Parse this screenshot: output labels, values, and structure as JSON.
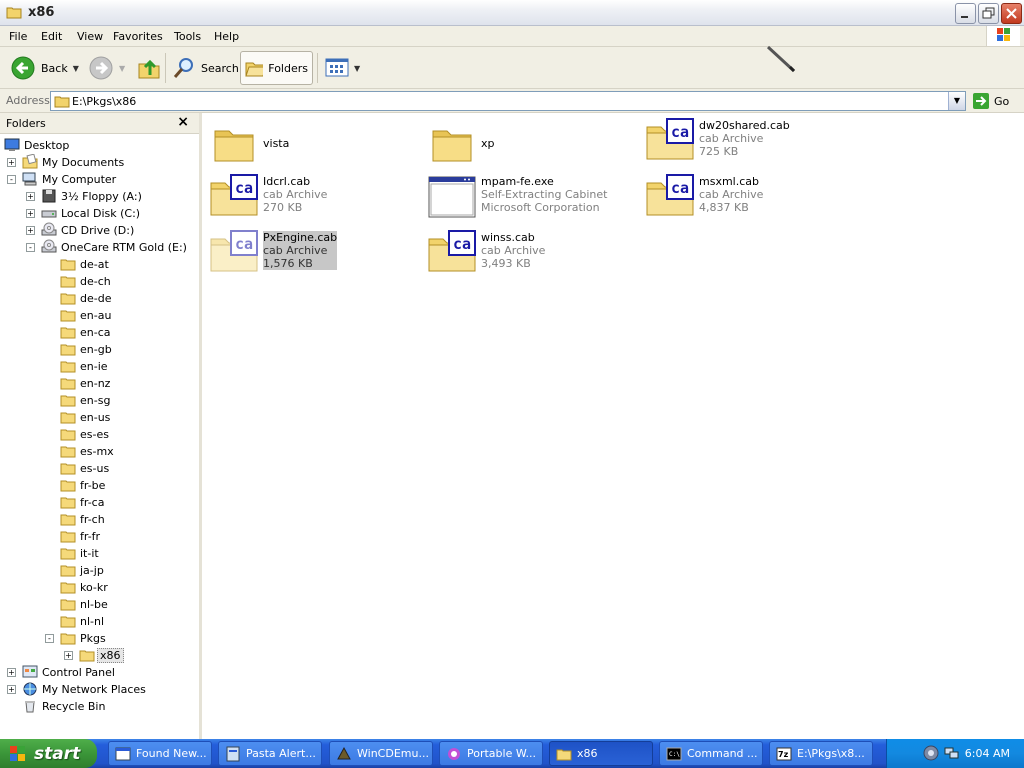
{
  "window": {
    "title": "x86"
  },
  "menu": [
    "File",
    "Edit",
    "View",
    "Favorites",
    "Tools",
    "Help"
  ],
  "toolbar": {
    "back": "Back",
    "search": "Search",
    "folders": "Folders"
  },
  "address": {
    "label": "Address",
    "value": "E:\\Pkgs\\x86",
    "go": "Go"
  },
  "folders_pane": {
    "title": "Folders",
    "tree": [
      "Desktop",
      "My Documents",
      "My Computer",
      "3½ Floppy (A:)",
      "Local Disk (C:)",
      "CD Drive (D:)",
      "OneCare RTM Gold (E:)",
      "de-at",
      "de-ch",
      "de-de",
      "en-au",
      "en-ca",
      "en-gb",
      "en-ie",
      "en-nz",
      "en-sg",
      "en-us",
      "es-es",
      "es-mx",
      "es-us",
      "fr-be",
      "fr-ca",
      "fr-ch",
      "fr-fr",
      "it-it",
      "ja-jp",
      "ko-kr",
      "nl-be",
      "nl-nl",
      "Pkgs",
      "x86",
      "Control Panel",
      "My Network Places",
      "Recycle Bin"
    ]
  },
  "files": [
    {
      "name": "vista",
      "type": "",
      "size": ""
    },
    {
      "name": "xp",
      "type": "",
      "size": ""
    },
    {
      "name": "dw20shared.cab",
      "type": "cab Archive",
      "size": "725 KB"
    },
    {
      "name": "Idcrl.cab",
      "type": "cab Archive",
      "size": "270 KB"
    },
    {
      "name": "mpam-fe.exe",
      "type": "Self-Extracting Cabinet",
      "size": "Microsoft Corporation"
    },
    {
      "name": "msxml.cab",
      "type": "cab Archive",
      "size": "4,837 KB"
    },
    {
      "name": "PxEngine.cab",
      "type": "cab Archive",
      "size": "1,576 KB"
    },
    {
      "name": "winss.cab",
      "type": "cab Archive",
      "size": "3,493 KB"
    }
  ],
  "taskbar": {
    "start": "start",
    "tasks": [
      "Found New...",
      "Pasta Alert...",
      "WinCDEmu...",
      "Portable W...",
      "x86",
      "Command ...",
      "E:\\Pkgs\\x8..."
    ],
    "clock": "6:04 AM"
  },
  "colors": {
    "taskbar": "#245edb",
    "start": "#3b9639",
    "folder": "#f5d97a",
    "cab": "#1a1aa6"
  }
}
